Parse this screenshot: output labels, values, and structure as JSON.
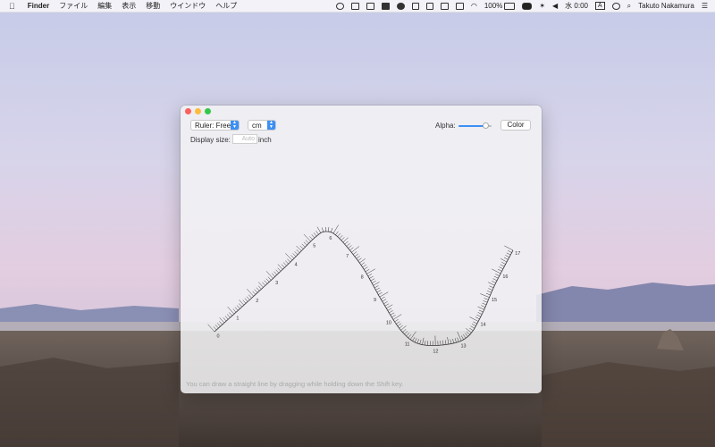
{
  "menubar": {
    "apple_symbol": "",
    "app_name": "Finder",
    "menus": [
      "ファイル",
      "編集",
      "表示",
      "移動",
      "ウインドウ",
      "ヘルプ"
    ],
    "battery": "100%",
    "clock": "水 0:00",
    "input_indicator": "A",
    "user": "Takuto Nakamura",
    "status_icons": [
      "creative-cloud-icon",
      "dropbox-icon",
      "document-icon",
      "mail-icon",
      "cloud-icon",
      "screen-icon",
      "square-icon",
      "window-icon",
      "calendar-icon",
      "wifi-icon",
      "battery-icon",
      "badge-icon",
      "bluetooth-icon",
      "volume-icon",
      "siri-icon",
      "spotlight-icon",
      "list-icon"
    ]
  },
  "window": {
    "ruler_mode": "Ruler: Free",
    "unit": "cm",
    "alpha_label": "Alpha:",
    "alpha_value": 0.82,
    "color_button": "Color",
    "display_size_label": "Display size:",
    "display_size_placeholder": "Auto",
    "display_size_unit": "inch",
    "hint": "You can draw a straight line by dragging while holding down the Shift key.",
    "ruler_labels": [
      "0",
      "1",
      "2",
      "3",
      "4",
      "5",
      "6",
      "7",
      "8",
      "9",
      "10",
      "11",
      "12",
      "13",
      "14",
      "15",
      "16",
      "17"
    ]
  },
  "colors": {
    "accent": "#3d8ff5",
    "close": "#fc605c",
    "minimize": "#fdbc40",
    "maximize": "#34c84a"
  }
}
